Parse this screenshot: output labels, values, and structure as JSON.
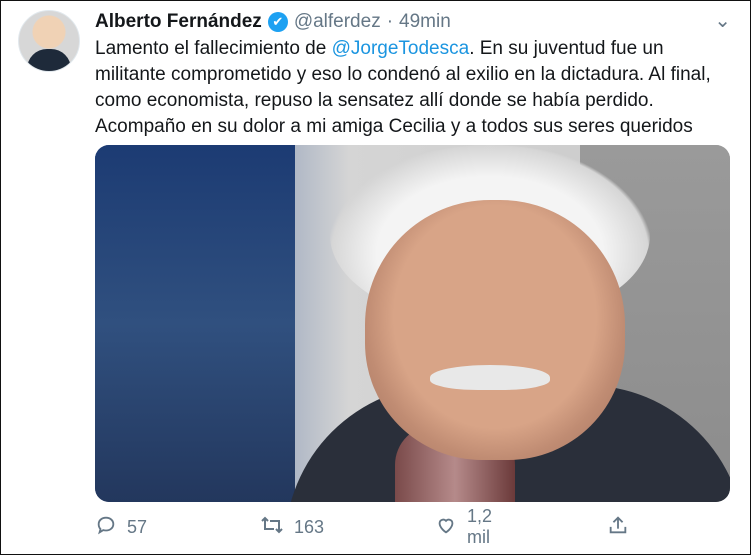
{
  "tweet": {
    "author_name": "Alberto Fernández",
    "verified_icon": "✔",
    "handle": "@alferdez",
    "separator": "·",
    "time": "49min",
    "text_before_mention": "Lamento el fallecimiento de ",
    "mention": "@JorgeTodesca",
    "text_after_mention": ". En su juventud fue un militante comprometido y eso lo condenó al exilio en la dictadura. Al final, como economista, repuso la sensatez allí donde se había perdido. Acompaño en su dolor a mi amiga Cecilia y a todos sus seres queridos"
  },
  "actions": {
    "reply_count": "57",
    "retweet_count": "163",
    "like_count": "1,2 mil"
  },
  "icons": {
    "more": "chevron-down-icon",
    "reply": "reply-icon",
    "retweet": "retweet-icon",
    "like": "heart-icon",
    "share": "share-icon"
  },
  "colors": {
    "link": "#1b95e0",
    "verified": "#1da1f2",
    "muted": "#657786"
  }
}
